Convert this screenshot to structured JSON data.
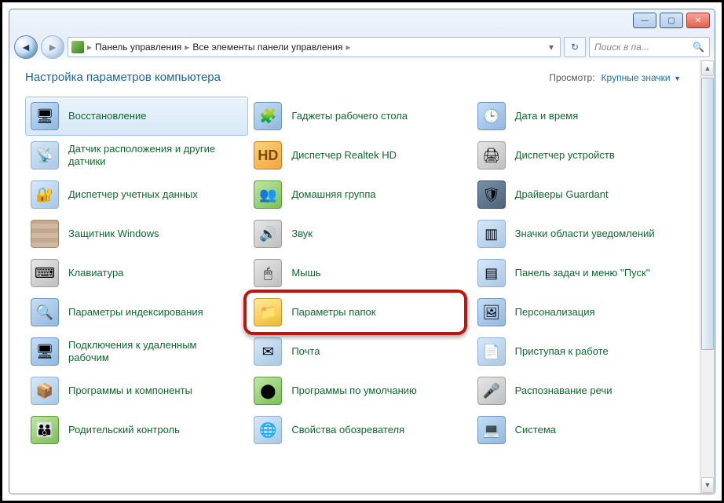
{
  "breadcrumb": {
    "root": "Панель управления",
    "segment": "Все элементы панели управления"
  },
  "search": {
    "placeholder": "Поиск в па..."
  },
  "header": {
    "title": "Настройка параметров компьютера",
    "view_label": "Просмотр:",
    "view_value": "Крупные значки"
  },
  "win": {
    "min": "—",
    "max": "▢",
    "close": "✕"
  },
  "items": {
    "r0c0": "Восстановление",
    "r0c1": "Гаджеты рабочего стола",
    "r0c2": "Дата и время",
    "r1c0": "Датчик расположения и другие датчики",
    "r1c1": "Диспетчер Realtek HD",
    "r1c2": "Диспетчер устройств",
    "r2c0": "Диспетчер учетных данных",
    "r2c1": "Домашняя группа",
    "r2c2": "Драйверы Guardant",
    "r3c0": "Защитник Windows",
    "r3c1": "Звук",
    "r3c2": "Значки области уведомлений",
    "r4c0": "Клавиатура",
    "r4c1": "Мышь",
    "r4c2": "Панель задач и меню ''Пуск''",
    "r5c0": "Параметры индексирования",
    "r5c1": "Параметры папок",
    "r5c2": "Персонализация",
    "r6c0": "Подключения к удаленным рабочим",
    "r6c1": "Почта",
    "r6c2": "Приступая к работе",
    "r7c0": "Программы и компоненты",
    "r7c1": "Программы по умолчанию",
    "r7c2": "Распознавание речи",
    "r8c0": "Родительский контроль",
    "r8c1": "Свойства обозревателя",
    "r8c2": "Система"
  }
}
